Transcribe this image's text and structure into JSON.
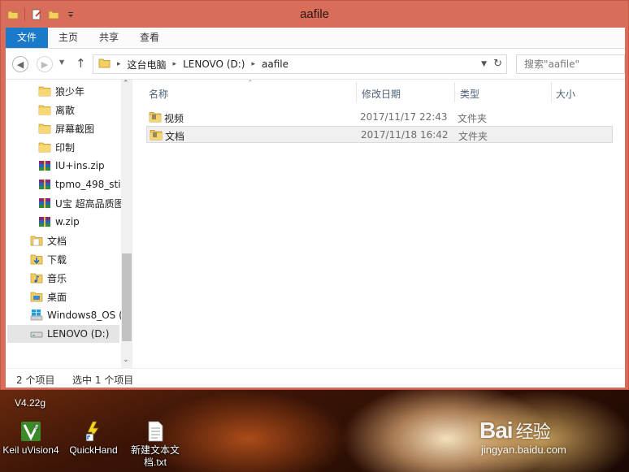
{
  "window": {
    "title": "aafile",
    "ribbon_tabs": [
      "文件",
      "主页",
      "共享",
      "查看"
    ]
  },
  "address": {
    "crumbs": [
      "这台电脑",
      "LENOVO (D:)",
      "aafile"
    ],
    "search_placeholder": "搜索\"aafile\""
  },
  "nav_pane": {
    "items": [
      {
        "label": "狼少年",
        "icon": "folder-icon",
        "level": 2
      },
      {
        "label": "离散",
        "icon": "folder-icon",
        "level": 2
      },
      {
        "label": "屏幕截图",
        "icon": "folder-icon",
        "level": 2
      },
      {
        "label": "印制",
        "icon": "folder-icon",
        "level": 2
      },
      {
        "label": "IU+ins.zip",
        "icon": "zip-archive-icon",
        "level": 2
      },
      {
        "label": "tpmo_498_stir",
        "icon": "zip-archive-icon",
        "level": 2
      },
      {
        "label": "U宝 超高品质图",
        "icon": "zip-archive-icon",
        "level": 2
      },
      {
        "label": "w.zip",
        "icon": "zip-archive-icon",
        "level": 2
      },
      {
        "label": "文档",
        "icon": "documents-library-icon",
        "level": 1
      },
      {
        "label": "下载",
        "icon": "downloads-icon",
        "level": 1
      },
      {
        "label": "音乐",
        "icon": "music-library-icon",
        "level": 1
      },
      {
        "label": "桌面",
        "icon": "desktop-folder-icon",
        "level": 1
      },
      {
        "label": "Windows8_OS (",
        "icon": "windows-drive-icon",
        "level": 1
      },
      {
        "label": "LENOVO (D:)",
        "icon": "drive-icon",
        "level": 1,
        "selected": true
      }
    ]
  },
  "file_list": {
    "columns": [
      "名称",
      "修改日期",
      "类型",
      "大小"
    ],
    "rows": [
      {
        "name": "视频",
        "date": "2017/11/17 22:43",
        "type": "文件夹",
        "size": ""
      },
      {
        "name": "文档",
        "date": "2017/11/18 16:42",
        "type": "文件夹",
        "size": "",
        "selected": true
      }
    ]
  },
  "status": {
    "count": "2 个项目",
    "selection": "选中 1 个项目"
  },
  "desktop": {
    "top_label": "V4.22g",
    "icons": [
      {
        "label": "Keil uVision4",
        "icon": "keil-uvision-icon"
      },
      {
        "label": "QuickHand",
        "icon": "quickhand-icon"
      },
      {
        "label": "新建文本文档.txt",
        "icon": "text-file-icon"
      }
    ],
    "watermark_brand": "Bai",
    "watermark_brand_cn": "经验",
    "watermark_url": "jingyan.baidu.com"
  },
  "colors": {
    "titlebar": "#d86d5a",
    "file_tab": "#1979ca",
    "folder_yellow": "#e9c15a"
  }
}
